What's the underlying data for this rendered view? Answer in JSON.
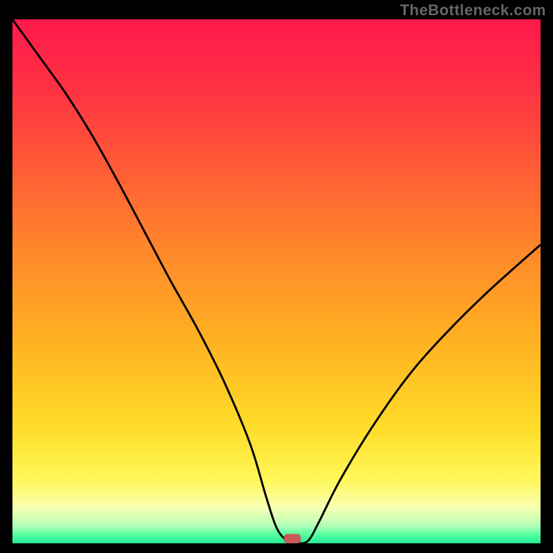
{
  "watermark": "TheBottleneck.com",
  "colors": {
    "curve_stroke": "#000000",
    "marker_fill": "#c85a5a"
  },
  "gradient_stops": [
    {
      "offset": 0.0,
      "color": "#ff1a4b"
    },
    {
      "offset": 0.12,
      "color": "#ff2f44"
    },
    {
      "offset": 0.28,
      "color": "#ff5a36"
    },
    {
      "offset": 0.45,
      "color": "#ff8a2a"
    },
    {
      "offset": 0.62,
      "color": "#ffb321"
    },
    {
      "offset": 0.78,
      "color": "#ffdd2a"
    },
    {
      "offset": 0.88,
      "color": "#fff85a"
    },
    {
      "offset": 0.93,
      "color": "#faffb0"
    },
    {
      "offset": 0.965,
      "color": "#b8ffb8"
    },
    {
      "offset": 0.985,
      "color": "#4dff9f"
    },
    {
      "offset": 1.0,
      "color": "#24e896"
    }
  ],
  "chart_data": {
    "type": "line",
    "title": "",
    "xlabel": "",
    "ylabel": "",
    "xlim": [
      0,
      100
    ],
    "ylim": [
      0,
      100
    ],
    "series": [
      {
        "name": "bottleneck-curve",
        "x": [
          0,
          5,
          10,
          15,
          20,
          25,
          30,
          35,
          40,
          45,
          48,
          50,
          52,
          54,
          56,
          58,
          62,
          68,
          75,
          82,
          90,
          100
        ],
        "values": [
          100,
          93,
          86,
          78,
          69,
          59.5,
          50,
          41,
          31,
          19,
          9,
          3,
          0.5,
          0,
          0.5,
          4,
          12,
          22,
          32,
          40,
          48,
          57
        ]
      }
    ],
    "marker": {
      "x": 53,
      "y": 0,
      "w": 3.2,
      "h": 1.8
    },
    "flat_bottom": {
      "x_start": 51,
      "x_end": 56,
      "y": 0.4
    }
  }
}
